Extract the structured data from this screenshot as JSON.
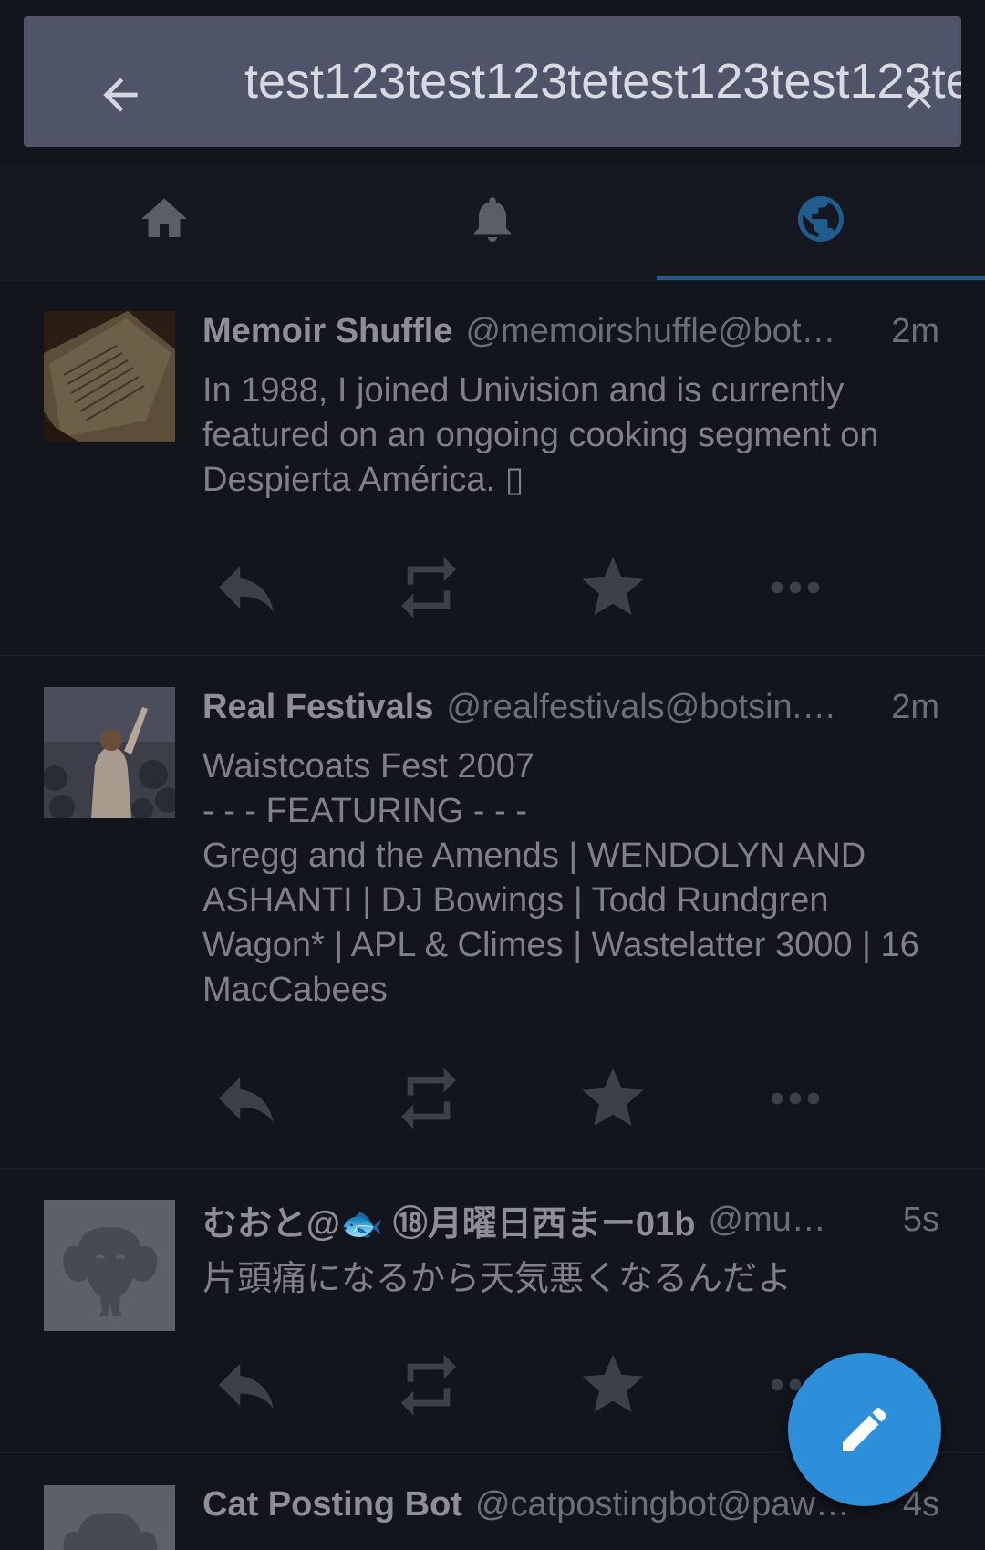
{
  "search": {
    "value": "test123test123tetest123test123te",
    "back_label": "Back",
    "clear_label": "Clear search"
  },
  "tabs": [
    {
      "icon": "home-icon",
      "label": "Home",
      "active": false
    },
    {
      "icon": "bell-icon",
      "label": "Notifications",
      "active": false
    },
    {
      "icon": "globe-icon",
      "label": "Federated timeline",
      "active": true
    }
  ],
  "statuses": [
    {
      "display_name": "Memoir Shuffle",
      "account": "@memoirshuffle@bot…",
      "time": "2m",
      "content": "In 1988, I joined Univision and is currently featured on an ongoing cooking segment on Despierta América. ▯"
    },
    {
      "display_name": "Real Festivals",
      "account": "@realfestivals@botsin.…",
      "time": "2m",
      "content": "Waistcoats Fest 2007\n- - - FEATURING - - -\nGregg and the Amends | WENDOLYN AND ASHANTI | DJ Bowings | Todd Rundgren Wagon* | APL & Climes | Wastelatter 3000 | 16 MacCabees"
    },
    {
      "display_name": "むおと@🐟 ⑱月曜日西まー01b",
      "account": "@mu…",
      "time": "5s",
      "content": "片頭痛になるから天気悪くなるんだよ"
    },
    {
      "display_name": "Cat Posting Bot",
      "account": "@catpostingbot@paw…",
      "time": "4s",
      "content": ""
    }
  ],
  "colors": {
    "background": "#13151c",
    "search_bar": "#505468",
    "tab_active": "#1e5d8d",
    "fab": "#2d8fd9"
  },
  "fab": {
    "icon": "pencil-icon",
    "label": "Compose"
  }
}
